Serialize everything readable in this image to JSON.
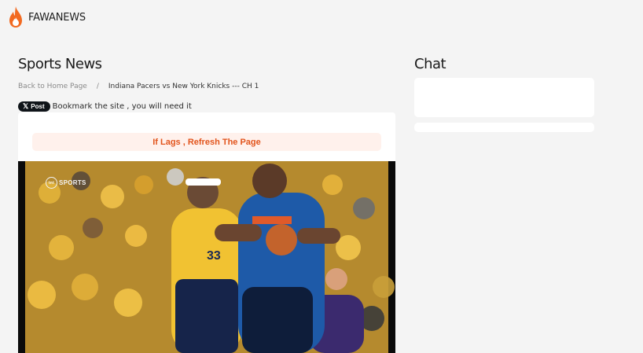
{
  "site": {
    "name": "FAWANEWS",
    "logo_icon": "flame-icon",
    "accent": "#f26a21"
  },
  "main": {
    "title": "Sports News",
    "breadcrumb": {
      "home": "Back to Home Page",
      "separator": "/",
      "current": "Indiana Pacers vs New York Knicks --- CH 1"
    },
    "xpost": {
      "label": "Post",
      "icon": "x-icon"
    },
    "bookmark_text": "Bookmark the site , you will need it",
    "lag_notice": "If Lags , Refresh The Page",
    "video": {
      "broadcaster": "SPORTS",
      "badge": "tnt",
      "jersey_number": "33"
    }
  },
  "sidebar": {
    "title": "Chat"
  }
}
